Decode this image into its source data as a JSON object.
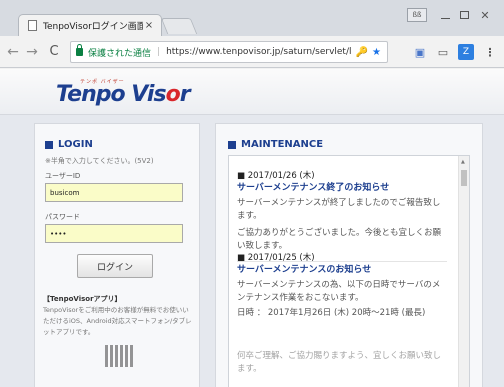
{
  "browser": {
    "tab_title": "TenpoVisorログイン画面",
    "tab_close": "×",
    "user_button": "ßß",
    "secure_label": "保護された通信",
    "separator": "|",
    "url": "https://www.tenpovisor.jp/saturn/servlet/l"
  },
  "icons": {
    "back": "←",
    "forward": "→",
    "reload": "C",
    "key": "🔑",
    "star": "★",
    "menu": "⋮",
    "close": "✕"
  },
  "header": {
    "logo_text_1": "Tenpo Vis",
    "logo_o": "o",
    "logo_text_2": "r",
    "logo_kana": "テンポ バイザー"
  },
  "login": {
    "heading": "LOGIN",
    "note": "※半角で入力してください。(5V2)",
    "user_label": "ユーザーID",
    "user_value": "busicom",
    "pass_label": "パスワード",
    "pass_value": "••••",
    "button": "ログイン",
    "app_title": "【TenpoVisorアプリ】",
    "app_desc": "TenpoVisorをご利用中のお客様が無料でお使いいただけるiOS、Android対応スマートフォン/タブレットアプリです。"
  },
  "maintenance": {
    "heading": "MAINTENANCE",
    "scroll_up": "▲",
    "items": [
      {
        "date": "■ 2017/01/26 (木)",
        "title": "サーバーメンテナンス終了のお知らせ",
        "body": "サーバーメンテナンスが終了しましたのでご報告致します。",
        "body2": "ご協力ありがとうございました。今後とも宜しくお願い致します。"
      },
      {
        "date": "■ 2017/01/25 (木)",
        "title": "サーバーメンテナンスのお知らせ",
        "body": "サーバーメンテナンスの為、以下の日時でサーバのメンテナンス作業をおこないます。",
        "body2": "日時 ： 2017年1月26日 (木) 20時〜21時 (最長)",
        "body3": "何卒ご理解、ご協力賜りますよう、宜しくお願い致します。"
      }
    ]
  }
}
